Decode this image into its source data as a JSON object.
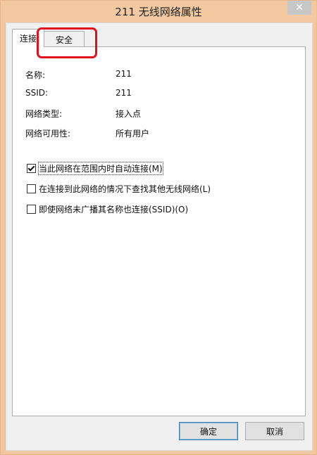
{
  "window": {
    "title": "211 无线网络属性"
  },
  "tabs": [
    {
      "label": "连接"
    },
    {
      "label": "安全"
    }
  ],
  "properties": [
    {
      "label": "名称:",
      "value": "211"
    },
    {
      "label": "SSID:",
      "value": "211"
    },
    {
      "label": "网络类型:",
      "value": "接入点"
    },
    {
      "label": "网络可用性:",
      "value": "所有用户"
    }
  ],
  "options": [
    {
      "label": "当此网络在范围内时自动连接(M)",
      "checked": true
    },
    {
      "label": "在连接到此网络的情况下查找其他无线网络(L)",
      "checked": false
    },
    {
      "label": "即使网络未广播其名称也连接(SSID)(O)",
      "checked": false
    }
  ],
  "buttons": {
    "ok": "确定",
    "cancel": "取消"
  },
  "colors": {
    "titlebar": "#f2c9a0",
    "highlight": "#e0101e"
  }
}
